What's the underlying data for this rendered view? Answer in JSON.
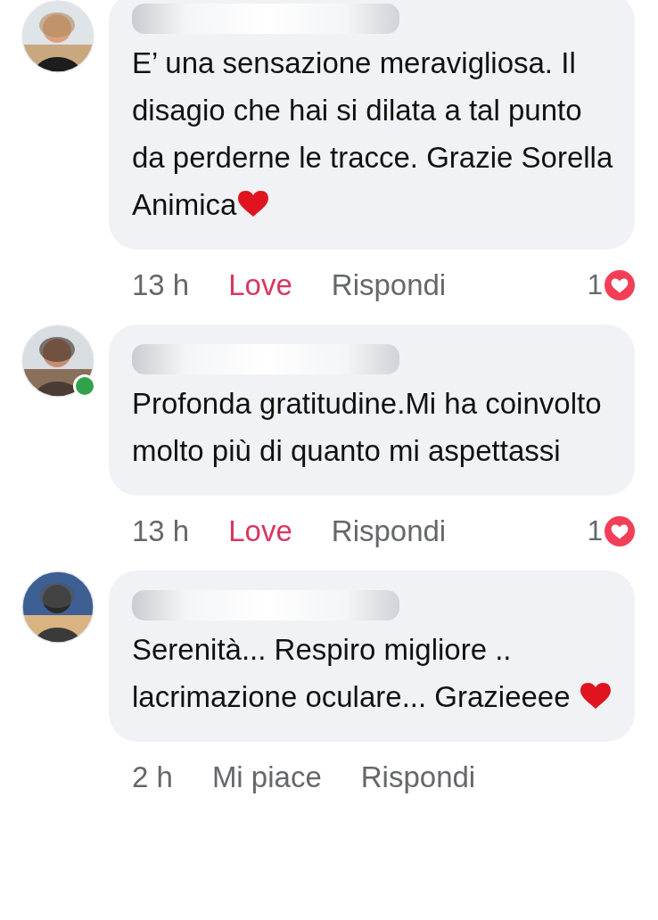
{
  "comments": [
    {
      "avatar": {
        "kind": "picture",
        "online": false
      },
      "text": "E’ una sensazione meravigliosa. Il disagio che hai si dilata a tal punto da perderne le tracce. Grazie Sorella Animica",
      "heart": true,
      "time": "13 h",
      "reaction_label": "Love",
      "reacted": true,
      "reply": "Rispondi",
      "reaction_count": "1",
      "top_cut": true
    },
    {
      "avatar": {
        "kind": "picture",
        "online": true
      },
      "text": "Profonda gratitudine.Mi ha coinvolto molto più di quanto mi aspettassi",
      "heart": false,
      "time": "13 h",
      "reaction_label": "Love",
      "reacted": true,
      "reply": "Rispondi",
      "reaction_count": "1",
      "top_cut": false
    },
    {
      "avatar": {
        "kind": "picture",
        "online": false
      },
      "text": "Serenità... Respiro migliore .. lacrimazione oculare... Grazieeee ",
      "heart": true,
      "time": "2 h",
      "reaction_label": "Mi piace",
      "reacted": false,
      "reply": "Rispondi",
      "top_cut": false
    }
  ]
}
